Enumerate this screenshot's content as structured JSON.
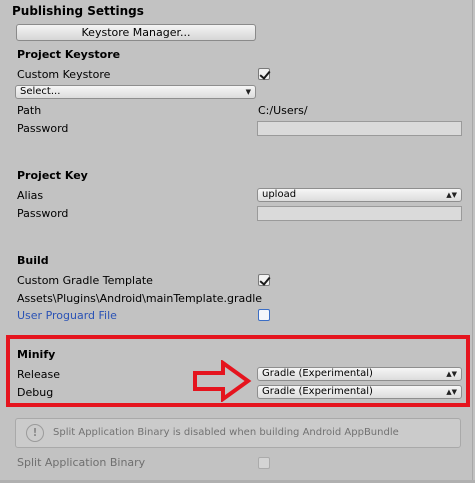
{
  "publishing": {
    "title": "Publishing Settings",
    "keystore_manager_button": "Keystore Manager..."
  },
  "project_keystore": {
    "title": "Project Keystore",
    "custom_keystore_label": "Custom Keystore",
    "custom_keystore_checked": true,
    "select_dropdown": "Select...",
    "path_label": "Path",
    "path_value": "C:/Users/",
    "password_label": "Password"
  },
  "project_key": {
    "title": "Project Key",
    "alias_label": "Alias",
    "alias_value": "upload",
    "password_label": "Password"
  },
  "build": {
    "title": "Build",
    "custom_gradle_label": "Custom Gradle Template",
    "custom_gradle_checked": true,
    "gradle_template_path": "Assets\\Plugins\\Android\\mainTemplate.gradle",
    "user_proguard_label": "User Proguard File",
    "user_proguard_checked": false
  },
  "minify": {
    "title": "Minify",
    "release_label": "Release",
    "release_value": "Gradle (Experimental)",
    "debug_label": "Debug",
    "debug_value": "Gradle (Experimental)"
  },
  "split_binary": {
    "help_text": "Split Application Binary is disabled when building Android AppBundle",
    "label": "Split Application Binary",
    "checked": false
  },
  "annotation": {
    "highlight_color": "#e5141e",
    "arrow_icon": "right-arrow-icon"
  }
}
